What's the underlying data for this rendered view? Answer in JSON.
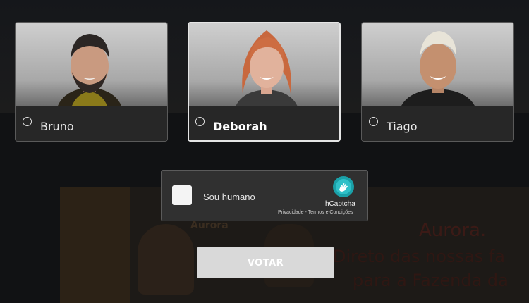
{
  "candidates": [
    {
      "name": "Bruno",
      "selected": false
    },
    {
      "name": "Deborah",
      "selected": true
    },
    {
      "name": "Tiago",
      "selected": false
    }
  ],
  "captcha": {
    "label": "Sou humano",
    "brand": "hCaptcha",
    "links": "Privacidade - Termos e Condições",
    "accent_color": "#0074bf",
    "icon": "hcaptcha-hand-icon"
  },
  "vote_button": {
    "label": "VOTAR"
  },
  "background": {
    "ad_brand": "Aurora.",
    "ad_line_1": "Direto das nossas fa",
    "ad_line_2": "para a Fazenda da",
    "product_brand": "Aurora"
  }
}
